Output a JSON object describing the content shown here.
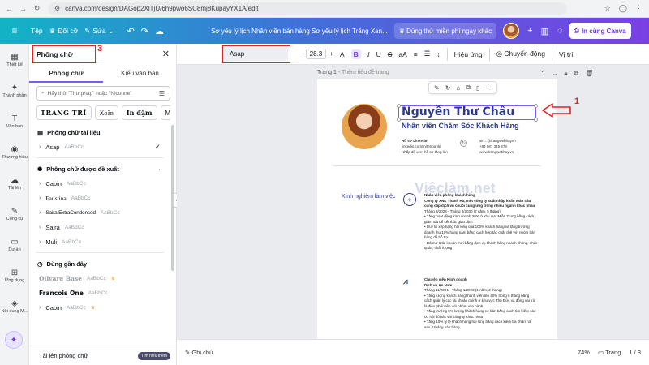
{
  "browser": {
    "url": "canva.com/design/DAGop2XlTjU/6h9pwo6SC8mj8KupayYX1A/edit"
  },
  "topbar": {
    "file_label": "Tệp",
    "resize_label": "Đổi cỡ",
    "edit_label": "Sửa",
    "doc_title": "Sơ yếu lý lịch Nhân viên bán hàng Sơ yếu lý lịch Trắng Xan...",
    "trial_label": "Dùng thử miễn phí ngay khác",
    "share_label": "In cùng Canva"
  },
  "rail": {
    "items": [
      {
        "icon": "template-icon",
        "label": "Thiết kế",
        "glyph": "▦"
      },
      {
        "icon": "elements-icon",
        "label": "Thành phần",
        "glyph": "✦"
      },
      {
        "icon": "text-icon",
        "label": "Văn bản",
        "glyph": "T"
      },
      {
        "icon": "brand-icon",
        "label": "Thương hiệu",
        "glyph": "◉"
      },
      {
        "icon": "upload-icon",
        "label": "Tải lên",
        "glyph": "☁"
      },
      {
        "icon": "tools-icon",
        "label": "Công cụ",
        "glyph": "✎"
      },
      {
        "icon": "projects-icon",
        "label": "Dự án",
        "glyph": "▭"
      },
      {
        "icon": "apps-icon",
        "label": "Ứng dụng",
        "glyph": "⊞"
      },
      {
        "icon": "recent-icon",
        "label": "Nội dung M...",
        "glyph": "◈"
      }
    ]
  },
  "panel": {
    "title": "Phông chữ",
    "number_label": "3",
    "tabs": [
      "Phông chữ",
      "Kiểu văn bản"
    ],
    "search_placeholder": "Hãy thử \"Thư pháp\" hoặc \"Niconne\"",
    "chips": [
      "TRANG TRÍ",
      "Xoăn",
      "In đậm",
      "Mộ"
    ],
    "doc_fonts_header": "Phông chữ tài liệu",
    "doc_fonts": [
      {
        "name": "Asap",
        "sample": "AaBbCc",
        "checked": true
      }
    ],
    "suggested_header": "Phông chữ được đề xuất",
    "suggested_dots": "···",
    "suggested_fonts": [
      {
        "name": "Cabin",
        "sample": "AaBbCc"
      },
      {
        "name": "Faustina",
        "sample": "AaBbCc"
      },
      {
        "name": "Saira ExtraCondensed",
        "sample": "AaBbCc"
      },
      {
        "name": "Saira",
        "sample": "AaBbCc"
      },
      {
        "name": "Muli",
        "sample": "AaBbCc"
      }
    ],
    "recent_header": "Dùng gần đây",
    "recent_fonts": [
      {
        "name": "Oilvare Base",
        "sample": "AaBbCc",
        "premium": true
      },
      {
        "name": "Francois One",
        "sample": "AaBbCc",
        "premium": false
      },
      {
        "name": "Cabin",
        "sample": "AaBbCc",
        "premium": true
      }
    ],
    "footer_label": "Tải lên phông chữ",
    "footer_pill": "Tìm hiểu thêm"
  },
  "toolbar": {
    "font_name": "Asap",
    "number_label": "2",
    "font_size": "28.3",
    "minus": "−",
    "plus": "+",
    "effects_label": "Hiệu ứng",
    "animate_label": "Chuyển động",
    "position_label": "Vị trí"
  },
  "canvas": {
    "page_label": "Trang 1",
    "page_sub": " - Thêm tiêu đề trang",
    "name": "Nguyễn Thư Châu",
    "role": "Nhân viên Chăm Sóc Khách Hàng",
    "number_label": "1",
    "contact_left": [
      "Hồ sơ LinkedIn",
      "linkedin.com/in/tenbanhi",
      "Nhấp để xem hồ sơ tăng lên"
    ],
    "contact_right": [
      "xin...@trangwebhayvn",
      "+84 987 345 678",
      "www.trangwebhay.vn"
    ],
    "watermark": "Việclàm.net",
    "section_label": "Kinh nghiệm làm việc",
    "job1": {
      "title": "Nhân viên phòng khách hàng",
      "company": "Công ty XNK Thanh Hà, một công ty xuất nhập khẩu toàn cầu cung cấp dịch vụ chuỗi cung ứng trong nhiều ngành khác nhau",
      "period": "Tháng 3/2023 - Tháng 8/2030 (7 năm, 5 tháng)",
      "bullets": [
        "• Tăng hoạt động kinh doanh 30% ở khu vực Miền Trung bằng cách giám sát để kết thúc giao dịch",
        "• Duy trì xếp hạng hài lòng của 100% khách hàng và tăng trưởng doanh thu 10% hàng năm bằng cách hợp tác chặt chẽ với nhóm bán hàng để hỗ trợ",
        "• Đã mở 5 tài khoản mới bằng dịch vụ khách hàng nhanh chóng, nhất quán, chất lượng"
      ]
    },
    "job2": {
      "title": "Chuyên viên Kinh doanh",
      "company": "Dịch vụ An Nam",
      "period": "Tháng 11/2021 - Tháng 1/2023 (1 năm, 2 tháng)",
      "bullets": [
        "• Tăng lượng khách hàng thành viên lên 40% trong 6 tháng bằng cách quản lý các tài khoản chính ở khu vực Thủ Đức và đồng vai trò là điều phối viên với nhóm vận hành",
        "• Tăng trưởng 5% lượng khách hàng cơ bản bằng cách tìm kiếm các cơ hội đối tác với công ty khác nhau",
        "• Tăng 10% tỷ lệ khách hàng hài lòng bằng cách kiểm tra phản hồi sau 3 tháng bán hàng"
      ]
    }
  },
  "bottombar": {
    "notes_label": "Ghi chú",
    "zoom": "74%",
    "pages_label": "Trang",
    "page_count": "1 / 3"
  },
  "colors": {
    "accent": "#7a5af8",
    "annotation_red": "#e02424",
    "resume_blue": "#2d3a8c"
  }
}
